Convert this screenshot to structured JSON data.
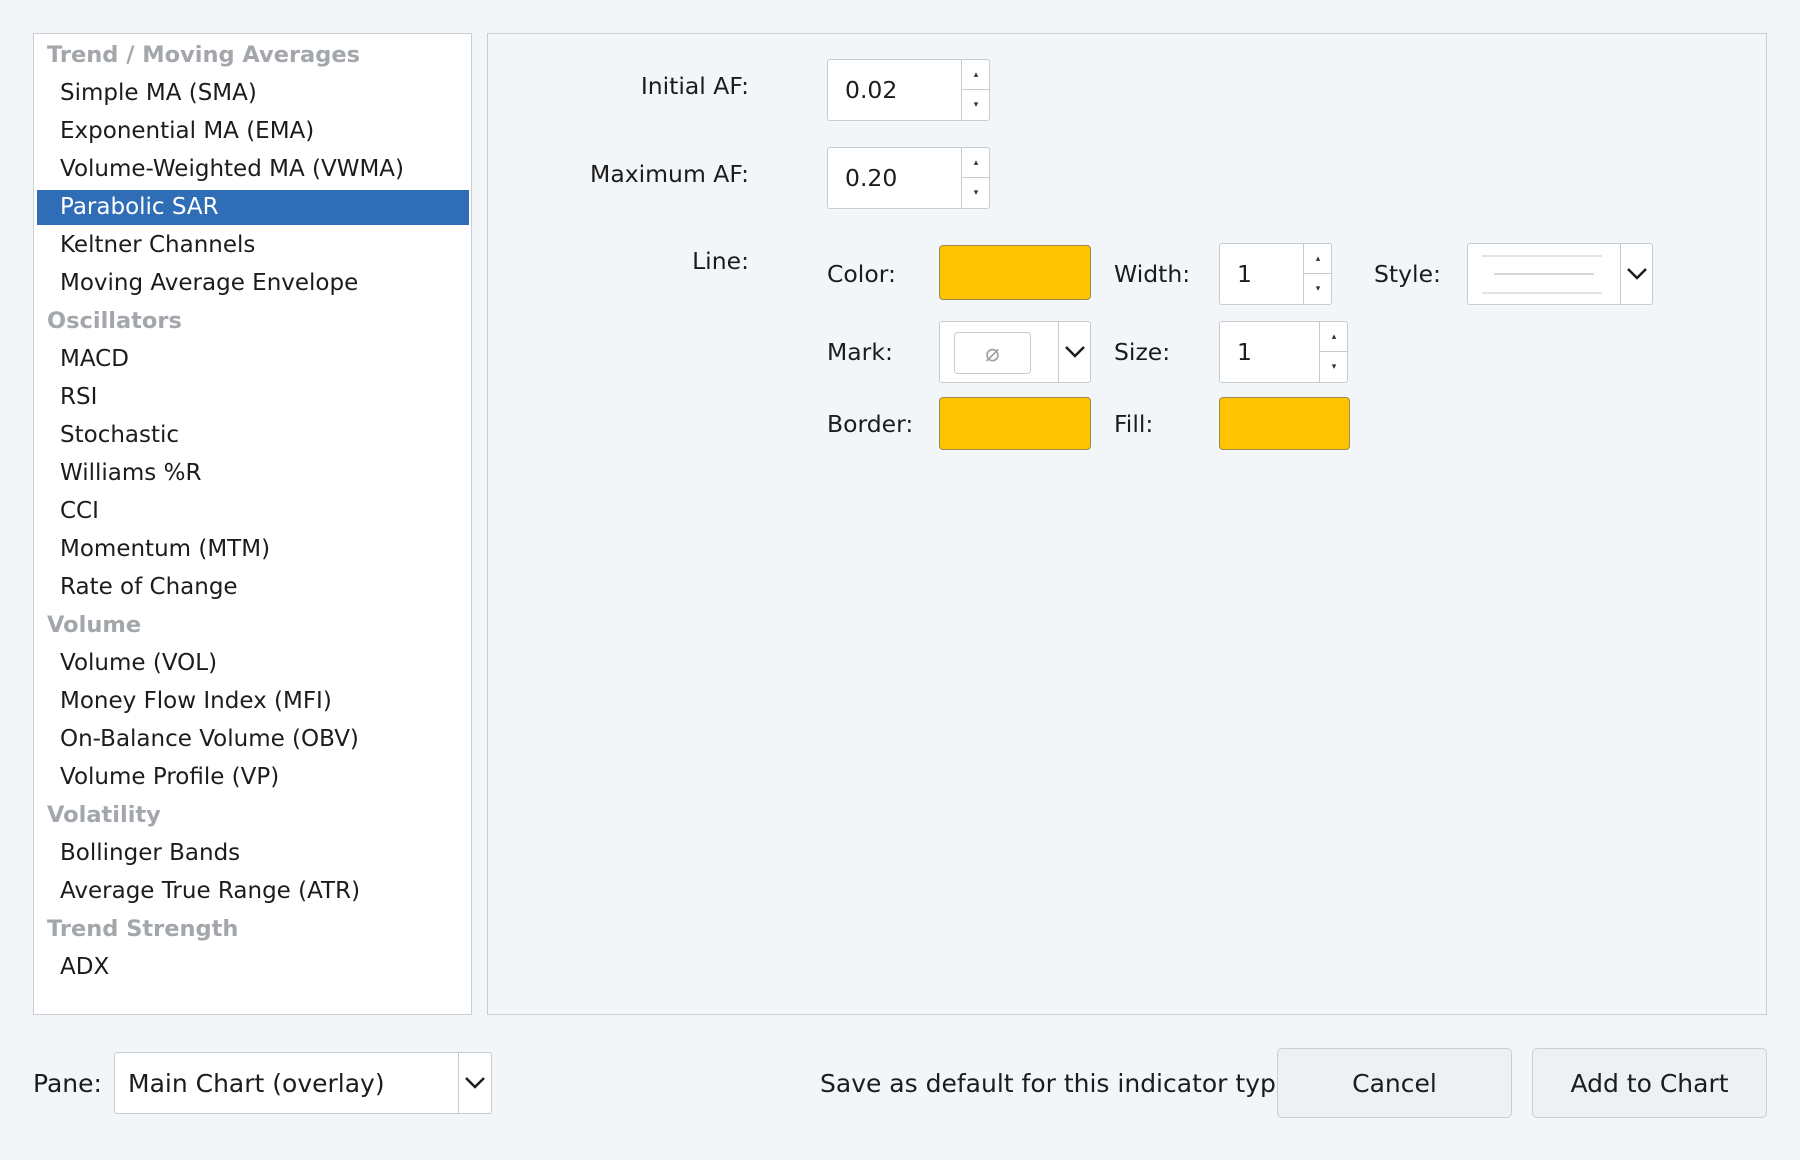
{
  "indicator_list": [
    {
      "type": "category",
      "label": "Trend / Moving Averages"
    },
    {
      "type": "item",
      "label": "Simple MA (SMA)"
    },
    {
      "type": "item",
      "label": "Exponential MA (EMA)"
    },
    {
      "type": "item",
      "label": "Volume-Weighted MA (VWMA)"
    },
    {
      "type": "item",
      "label": "Parabolic SAR",
      "selected": true
    },
    {
      "type": "item",
      "label": "Keltner Channels"
    },
    {
      "type": "item",
      "label": "Moving Average Envelope"
    },
    {
      "type": "category",
      "label": "Oscillators"
    },
    {
      "type": "item",
      "label": "MACD"
    },
    {
      "type": "item",
      "label": "RSI"
    },
    {
      "type": "item",
      "label": "Stochastic"
    },
    {
      "type": "item",
      "label": "Williams %R"
    },
    {
      "type": "item",
      "label": "CCI"
    },
    {
      "type": "item",
      "label": "Momentum (MTM)"
    },
    {
      "type": "item",
      "label": "Rate of Change"
    },
    {
      "type": "category",
      "label": "Volume"
    },
    {
      "type": "item",
      "label": "Volume (VOL)"
    },
    {
      "type": "item",
      "label": "Money Flow Index (MFI)"
    },
    {
      "type": "item",
      "label": "On-Balance Volume (OBV)"
    },
    {
      "type": "item",
      "label": "Volume Profile (VP)"
    },
    {
      "type": "category",
      "label": "Volatility"
    },
    {
      "type": "item",
      "label": "Bollinger Bands"
    },
    {
      "type": "item",
      "label": "Average True Range (ATR)"
    },
    {
      "type": "category",
      "label": "Trend Strength"
    },
    {
      "type": "item",
      "label": "ADX"
    }
  ],
  "settings": {
    "initial_af": {
      "label": "Initial AF:",
      "value": "0.02"
    },
    "maximum_af": {
      "label": "Maximum AF:",
      "value": "0.20"
    },
    "line": {
      "label": "Line:",
      "color_label": "Color:",
      "width_label": "Width:",
      "width_value": "1",
      "style_label": "Style:",
      "mark_label": "Mark:",
      "mark_symbol": "⌀",
      "size_label": "Size:",
      "size_value": "1",
      "border_label": "Border:",
      "fill_label": "Fill:"
    }
  },
  "colors": {
    "line_color": "#ffc400",
    "border_color": "#ffc400",
    "fill_color": "#ffc400",
    "selection": "#2f6db6"
  },
  "footer": {
    "pane_label": "Pane:",
    "pane_value": "Main Chart (overlay)",
    "save_default_label": "Save as default for this indicator type",
    "cancel_label": "Cancel",
    "add_label": "Add to Chart"
  }
}
